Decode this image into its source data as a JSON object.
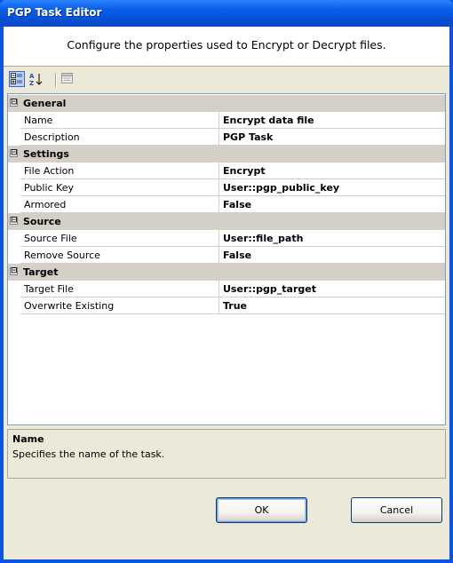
{
  "window": {
    "title": "PGP Task Editor"
  },
  "header": {
    "text": "Configure the properties used to Encrypt or Decrypt files."
  },
  "toolbar": {
    "buttons": [
      {
        "icon": "categorized-icon",
        "active": true
      },
      {
        "icon": "alphabetical-sort-icon",
        "active": false
      },
      {
        "icon": "property-pages-icon",
        "active": false
      }
    ]
  },
  "grid": {
    "categories": [
      {
        "name": "General",
        "expander": "⊟",
        "rows": [
          {
            "name": "Name",
            "value": "Encrypt data file"
          },
          {
            "name": "Description",
            "value": "PGP Task"
          }
        ]
      },
      {
        "name": "Settings",
        "expander": "⊟",
        "rows": [
          {
            "name": "File Action",
            "value": "Encrypt"
          },
          {
            "name": "Public Key",
            "value": "User::pgp_public_key"
          },
          {
            "name": "Armored",
            "value": "False"
          }
        ]
      },
      {
        "name": "Source",
        "expander": "⊟",
        "rows": [
          {
            "name": "Source File",
            "value": "User::file_path"
          },
          {
            "name": "Remove Source",
            "value": "False"
          }
        ]
      },
      {
        "name": "Target",
        "expander": "⊟",
        "rows": [
          {
            "name": "Target File",
            "value": "User::pgp_target"
          },
          {
            "name": "Overwrite Existing",
            "value": "True"
          }
        ]
      }
    ]
  },
  "description": {
    "title": "Name",
    "text": "Specifies the name of the task."
  },
  "buttons": {
    "ok": "OK",
    "cancel": "Cancel"
  }
}
